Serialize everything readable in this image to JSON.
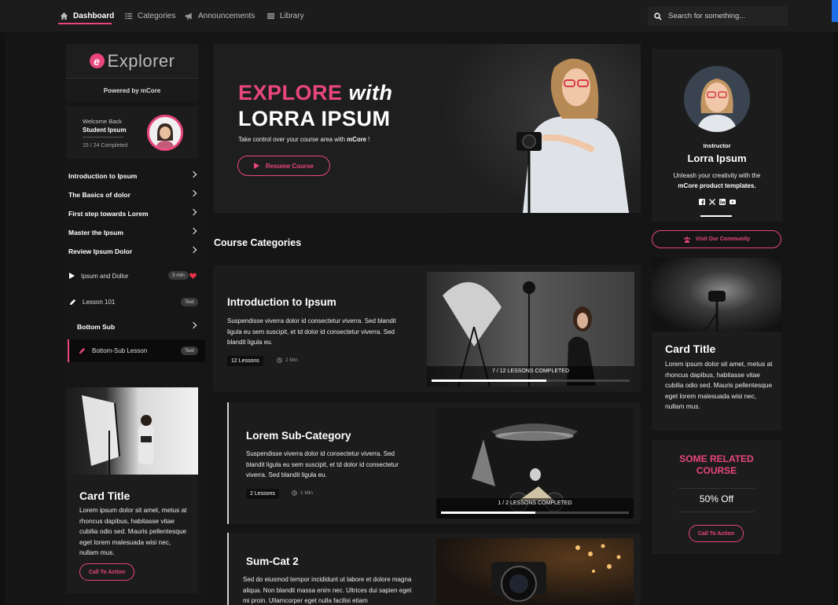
{
  "nav": {
    "items": [
      {
        "label": "Dashboard",
        "icon": "home-icon",
        "active": true
      },
      {
        "label": "Categories",
        "icon": "list-icon",
        "active": false
      },
      {
        "label": "Announcements",
        "icon": "megaphone-icon",
        "active": false
      },
      {
        "label": "Library",
        "icon": "library-icon",
        "active": false
      }
    ],
    "search_placeholder": "Search for something..."
  },
  "sidebar": {
    "logo_letter": "e",
    "logo_text": "Explorer",
    "powered_by": "Powered by mCore",
    "welcome": {
      "greeting": "Welcome Back",
      "name": "Student Ipsum",
      "progress": "15 / 24 Completed"
    },
    "menu": [
      "Introduction to Ipsum",
      "The Basics of dolor",
      "First step towards Lorem",
      "Master the Ipsum",
      "Review Ipsum Dolor"
    ],
    "lessons": [
      {
        "label": "Ipsum and Dollor",
        "badge": "3 min",
        "icon": "play-icon"
      },
      {
        "label": "Lesson 101",
        "badge": "Text",
        "icon": "pencil-icon"
      }
    ],
    "bottom_sub": "Bottom Sub",
    "bottom_sub_lesson": {
      "label": "Bottom-Sub Lesson",
      "badge": "Text"
    },
    "card": {
      "title": "Card Title",
      "text": "Lorem ipsum dolor sit amet, metus at rhoncus dapibus, habitasse vitae cubilia odio sed. Mauris pellentesque eget lorem malesuada wisi nec, nullam mus.",
      "cta": "Call To Action"
    }
  },
  "hero": {
    "word1": "EXPLORE",
    "word2": "with",
    "name": "LORRA IPSUM",
    "subtitle_pre": "Take control over your course area with ",
    "subtitle_bold": "mCore",
    "subtitle_post": " !",
    "button": "Resume Course"
  },
  "main": {
    "section_title": "Course Categories",
    "courses": [
      {
        "title": "Introduction to Ipsum",
        "desc": "Suspendisse viverra dolor id consectetur viverra. Sed blandit ligula eu sem suscipit, et td dolor id consectetur viverra. Sed blandit ligula eu.",
        "lessons": "12 Lessons",
        "duration": "2 Min",
        "progress_text": "7 / 12  LESSONS COMPLETED",
        "progress": 0.58
      },
      {
        "title": "Lorem Sub-Category",
        "desc": "Suspendisse viverra dolor id consectetur viverra. Sed blandit ligula eu sem suscipit, et td dolor id consectetur viverra. Sed blandit ligula eu.",
        "lessons": "2 Lessons",
        "duration": "1 Min",
        "progress_text": "1 / 2  LESSONS COMPLETED",
        "progress": 0.5
      },
      {
        "title": "Sum-Cat 2",
        "desc": "Sed do eiusmod tempor incididunt ut labore et dolore magna aliqua. Non blandit massa enim nec. Ultrices dui sapien eget mi proin. Ullamcorper eget nulla facilisi etiam"
      }
    ]
  },
  "right": {
    "instructor": {
      "role": "Instructor",
      "name": "Lorra Ipsum",
      "desc_line1": "Unleash your creativity with the",
      "desc_bold": "mCore product templates.",
      "socials": [
        "facebook-icon",
        "x-icon",
        "linkedin-icon",
        "youtube-icon"
      ]
    },
    "community_button": "Visit Our Community",
    "card": {
      "title": "Card Title",
      "text": "Lorem ipsum dolor sit amet, metus at rhoncus dapibus, habitasse vitae cubilia odio sed. Mauris pellentesque eget lorem malesuada wisi nec, nullam mus."
    },
    "related": {
      "title_line1": "SOME RELATED",
      "title_line2": "COURSE",
      "offer": "50% Off",
      "cta": "Call To Action"
    }
  },
  "colors": {
    "accent": "#e8467c",
    "background": "#111111",
    "panel": "#1c1c1c"
  }
}
